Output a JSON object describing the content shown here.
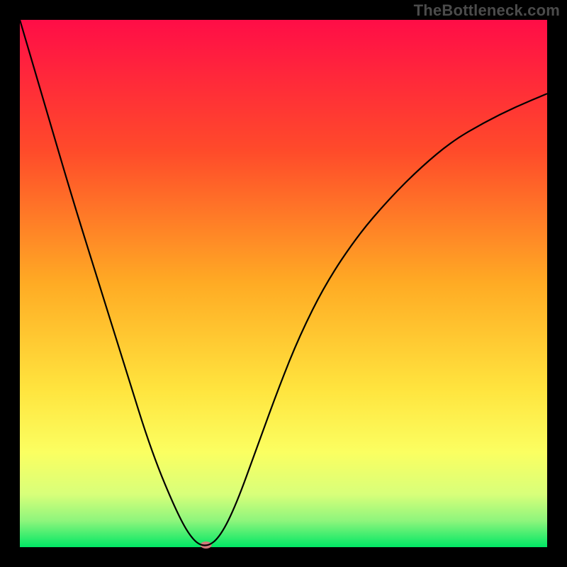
{
  "watermark": "TheBottleneck.com",
  "chart_data": {
    "type": "line",
    "title": "",
    "xlabel": "",
    "ylabel": "",
    "xlim": [
      0,
      100
    ],
    "ylim": [
      0,
      100
    ],
    "background_gradient": {
      "stops": [
        {
          "offset": 0,
          "color": "#ff0d47"
        },
        {
          "offset": 0.25,
          "color": "#ff4b2a"
        },
        {
          "offset": 0.5,
          "color": "#ffab24"
        },
        {
          "offset": 0.7,
          "color": "#ffe43e"
        },
        {
          "offset": 0.82,
          "color": "#fbff61"
        },
        {
          "offset": 0.9,
          "color": "#d8ff7a"
        },
        {
          "offset": 0.95,
          "color": "#8ef57c"
        },
        {
          "offset": 1.0,
          "color": "#00e765"
        }
      ]
    },
    "series": [
      {
        "name": "bottleneck-curve",
        "color": "#000000",
        "x": [
          0,
          5,
          10,
          15,
          20,
          25,
          30,
          33,
          35.5,
          38,
          41,
          45,
          49,
          53,
          58,
          64,
          70,
          76,
          82,
          88,
          94,
          100
        ],
        "y": [
          100,
          83,
          66,
          50,
          34,
          18,
          6,
          1,
          0,
          2,
          8,
          19,
          30,
          40,
          50,
          59,
          66,
          72,
          77,
          80.5,
          83.5,
          86
        ]
      }
    ],
    "points": [
      {
        "name": "optimal-marker",
        "x": 35.3,
        "y": 0.4,
        "color": "#d07b7b",
        "rx": 8,
        "ry": 5
      }
    ]
  }
}
